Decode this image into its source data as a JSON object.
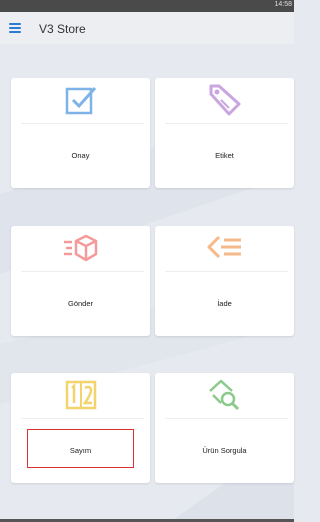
{
  "status_bar": {
    "time": "14:58"
  },
  "app_bar": {
    "title": "V3 Store",
    "menu_icon": "hamburger-menu-icon"
  },
  "tiles": [
    {
      "id": "onay",
      "label": "Onay",
      "icon": "checkbox-check-icon",
      "color": "#7fb3e8"
    },
    {
      "id": "etiket",
      "label": "Etiket",
      "icon": "tag-icon",
      "color": "#c9a6e0"
    },
    {
      "id": "gonder",
      "label": "Gönder",
      "icon": "send-box-icon",
      "color": "#f49a9a"
    },
    {
      "id": "iade",
      "label": "İade",
      "icon": "return-arrow-icon",
      "color": "#f5b98a"
    },
    {
      "id": "sayim",
      "label": "Sayım",
      "icon": "count-numbers-icon",
      "color": "#f3d36b"
    },
    {
      "id": "urun_sorgula",
      "label": "Ürün Sorgula",
      "icon": "product-search-icon",
      "color": "#8cc98c"
    }
  ]
}
